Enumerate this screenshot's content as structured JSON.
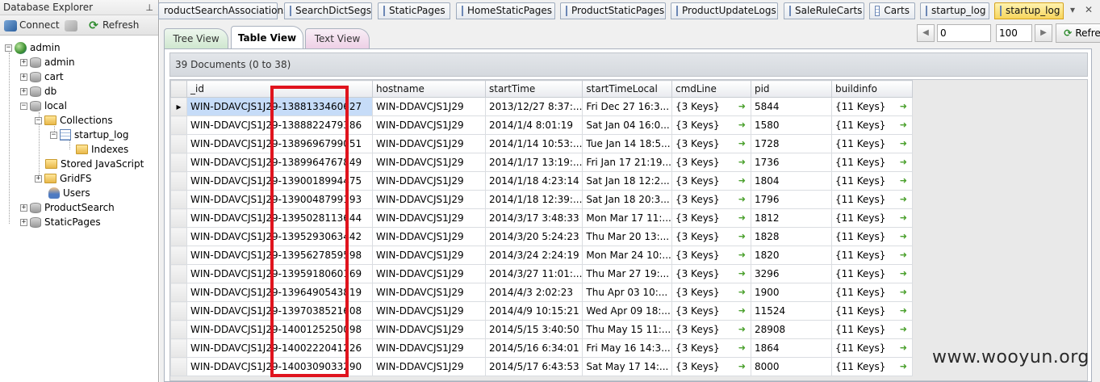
{
  "explorer": {
    "title": "Database Explorer",
    "connect_label": "Connect",
    "refresh_label": "Refresh",
    "tree": {
      "root": "admin",
      "admin": "admin",
      "cart": "cart",
      "db": "db",
      "local": "local",
      "collections": "Collections",
      "startup_log": "startup_log",
      "indexes": "Indexes",
      "stored_js": "Stored JavaScript",
      "gridfs": "GridFS",
      "users": "Users",
      "productsearch": "ProductSearch",
      "staticpages": "StaticPages"
    }
  },
  "doc_tabs": [
    "roductSearchAssociations",
    "SearchDictSegs",
    "StaticPages",
    "HomeStaticPages",
    "ProductStaticPages",
    "ProductUpdateLogs",
    "SaleRuleCarts",
    "Carts",
    "startup_log",
    "startup_log"
  ],
  "view_tabs": {
    "tree": "Tree View",
    "table": "Table View",
    "text": "Text View"
  },
  "pager": {
    "skip": "0",
    "limit": "100",
    "refresh": "Refresh"
  },
  "count_text": "39 Documents (0 to 38)",
  "columns": [
    "_id",
    "hostname",
    "startTime",
    "startTimeLocal",
    "cmdLine",
    "pid",
    "buildinfo"
  ],
  "rows": [
    {
      "id": "WIN-DDAVCJS1J29-1388133460627",
      "host": "WIN-DDAVCJS1J29",
      "st": "2013/12/27 8:37:...",
      "stl": "Fri Dec 27 16:3...",
      "cmd": "{3 Keys}",
      "pid": "5844",
      "build": "{11 Keys}"
    },
    {
      "id": "WIN-DDAVCJS1J29-1388822479386",
      "host": "WIN-DDAVCJS1J29",
      "st": "2014/1/4 8:01:19",
      "stl": "Sat Jan 04 16:0...",
      "cmd": "{3 Keys}",
      "pid": "1580",
      "build": "{11 Keys}"
    },
    {
      "id": "WIN-DDAVCJS1J29-1389696799051",
      "host": "WIN-DDAVCJS1J29",
      "st": "2014/1/14 10:53:...",
      "stl": "Tue Jan 14 18:5...",
      "cmd": "{3 Keys}",
      "pid": "1728",
      "build": "{11 Keys}"
    },
    {
      "id": "WIN-DDAVCJS1J29-1389964767849",
      "host": "WIN-DDAVCJS1J29",
      "st": "2014/1/17 13:19:...",
      "stl": "Fri Jan 17 21:19...",
      "cmd": "{3 Keys}",
      "pid": "1736",
      "build": "{11 Keys}"
    },
    {
      "id": "WIN-DDAVCJS1J29-1390018994475",
      "host": "WIN-DDAVCJS1J29",
      "st": "2014/1/18 4:23:14",
      "stl": "Sat Jan 18 12:2...",
      "cmd": "{3 Keys}",
      "pid": "1804",
      "build": "{11 Keys}"
    },
    {
      "id": "WIN-DDAVCJS1J29-1390048799193",
      "host": "WIN-DDAVCJS1J29",
      "st": "2014/1/18 12:39:...",
      "stl": "Sat Jan 18 20:3...",
      "cmd": "{3 Keys}",
      "pid": "1796",
      "build": "{11 Keys}"
    },
    {
      "id": "WIN-DDAVCJS1J29-1395028113644",
      "host": "WIN-DDAVCJS1J29",
      "st": "2014/3/17 3:48:33",
      "stl": "Mon Mar 17 11:...",
      "cmd": "{3 Keys}",
      "pid": "1812",
      "build": "{11 Keys}"
    },
    {
      "id": "WIN-DDAVCJS1J29-1395293063442",
      "host": "WIN-DDAVCJS1J29",
      "st": "2014/3/20 5:24:23",
      "stl": "Thu Mar 20 13:...",
      "cmd": "{3 Keys}",
      "pid": "1828",
      "build": "{11 Keys}"
    },
    {
      "id": "WIN-DDAVCJS1J29-1395627859598",
      "host": "WIN-DDAVCJS1J29",
      "st": "2014/3/24 2:24:19",
      "stl": "Mon Mar 24 10:...",
      "cmd": "{3 Keys}",
      "pid": "1820",
      "build": "{11 Keys}"
    },
    {
      "id": "WIN-DDAVCJS1J29-1395918060169",
      "host": "WIN-DDAVCJS1J29",
      "st": "2014/3/27 11:01:...",
      "stl": "Thu Mar 27 19:...",
      "cmd": "{3 Keys}",
      "pid": "3296",
      "build": "{11 Keys}"
    },
    {
      "id": "WIN-DDAVCJS1J29-1396490543819",
      "host": "WIN-DDAVCJS1J29",
      "st": "2014/4/3 2:02:23",
      "stl": "Thu Apr 03 10:...",
      "cmd": "{3 Keys}",
      "pid": "1900",
      "build": "{11 Keys}"
    },
    {
      "id": "WIN-DDAVCJS1J29-1397038521608",
      "host": "WIN-DDAVCJS1J29",
      "st": "2014/4/9 10:15:21",
      "stl": "Wed Apr 09 18:...",
      "cmd": "{3 Keys}",
      "pid": "11524",
      "build": "{11 Keys}"
    },
    {
      "id": "WIN-DDAVCJS1J29-1400125250098",
      "host": "WIN-DDAVCJS1J29",
      "st": "2014/5/15 3:40:50",
      "stl": "Thu May 15 11:...",
      "cmd": "{3 Keys}",
      "pid": "28908",
      "build": "{11 Keys}"
    },
    {
      "id": "WIN-DDAVCJS1J29-1400222041226",
      "host": "WIN-DDAVCJS1J29",
      "st": "2014/5/16 6:34:01",
      "stl": "Fri May 16 14:3...",
      "cmd": "{3 Keys}",
      "pid": "1864",
      "build": "{11 Keys}"
    },
    {
      "id": "WIN-DDAVCJS1J29-1400309033290",
      "host": "WIN-DDAVCJS1J29",
      "st": "2014/5/17 6:43:53",
      "stl": "Sat May 17 14:...",
      "cmd": "{3 Keys}",
      "pid": "8000",
      "build": "{11 Keys}"
    }
  ],
  "watermark": "www.wooyun.org",
  "colors": {
    "highlight": "#e0141e",
    "active_tab": "#f7d55d",
    "arrow": "#4aa02c"
  }
}
